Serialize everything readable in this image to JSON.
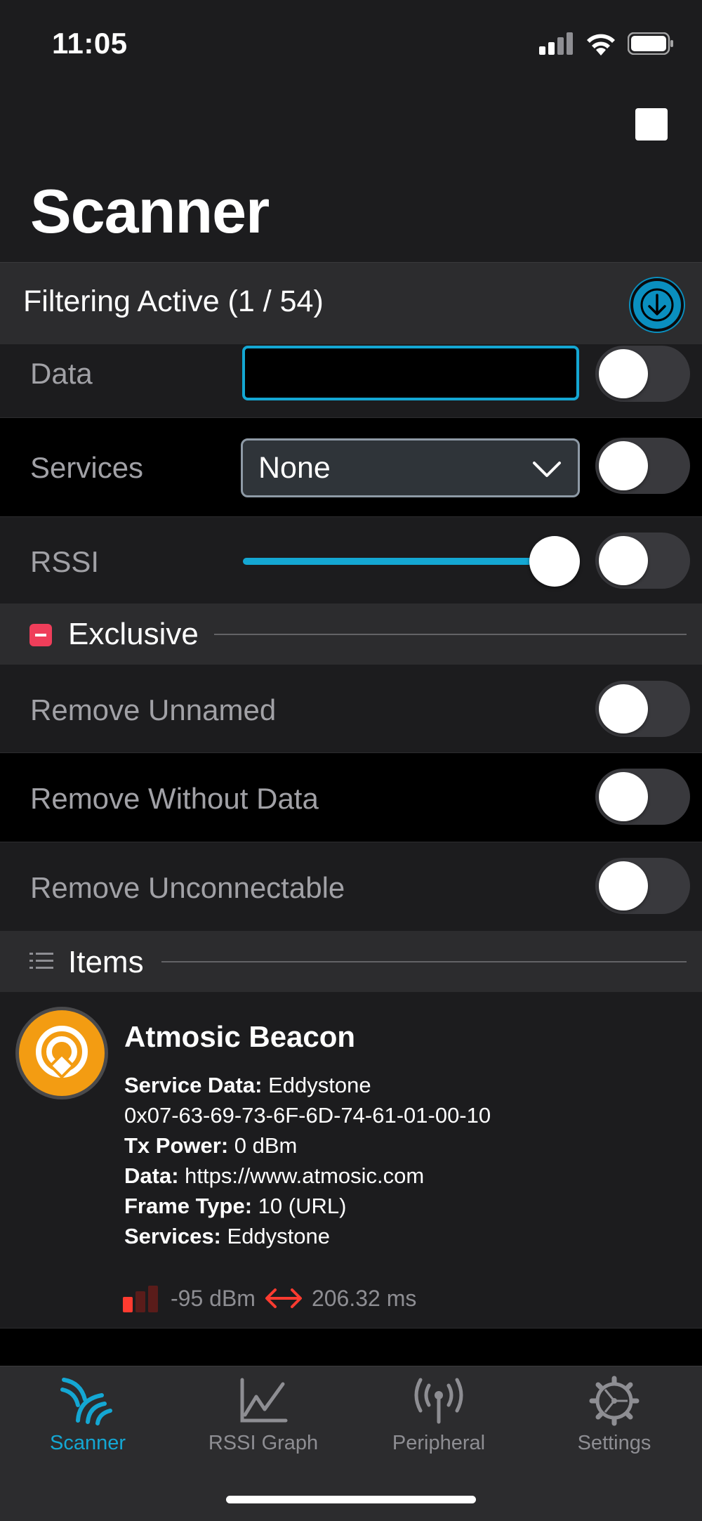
{
  "status": {
    "time": "11:05"
  },
  "header": {
    "title": "Scanner"
  },
  "filter": {
    "label": "Filtering Active (1 / 54)"
  },
  "rows": {
    "data": {
      "label": "Data",
      "value": ""
    },
    "services": {
      "label": "Services",
      "selected": "None"
    },
    "rssi": {
      "label": "RSSI",
      "value": 0.9
    }
  },
  "exclusive": {
    "title": "Exclusive",
    "items": [
      {
        "label": "Remove Unnamed"
      },
      {
        "label": "Remove Without Data"
      },
      {
        "label": "Remove Unconnectable"
      }
    ]
  },
  "items_section": {
    "title": "Items"
  },
  "device": {
    "name": "Atmosic Beacon",
    "service_data_key": "Service Data:",
    "service_data_val": "Eddystone",
    "raw": "0x07-63-69-73-6F-6D-74-61-01-00-10",
    "tx_key": "Tx Power:",
    "tx_val": "0 dBm",
    "data_key": "Data:",
    "data_val": "https://www.atmosic.com",
    "frame_key": "Frame Type:",
    "frame_val": "10 (URL)",
    "services_key": "Services:",
    "services_val": "Eddystone",
    "rssi": "-95 dBm",
    "interval": "206.32 ms"
  },
  "tabs": [
    {
      "label": "Scanner",
      "icon": "scanner-icon"
    },
    {
      "label": "RSSI Graph",
      "icon": "graph-icon"
    },
    {
      "label": "Peripheral",
      "icon": "antenna-icon"
    },
    {
      "label": "Settings",
      "icon": "gear-icon"
    }
  ],
  "colors": {
    "accent": "#14a7d3",
    "exclusive": "#ef3e5a",
    "avatar": "#f39c12",
    "rssi_bar": "#ff3b30"
  }
}
